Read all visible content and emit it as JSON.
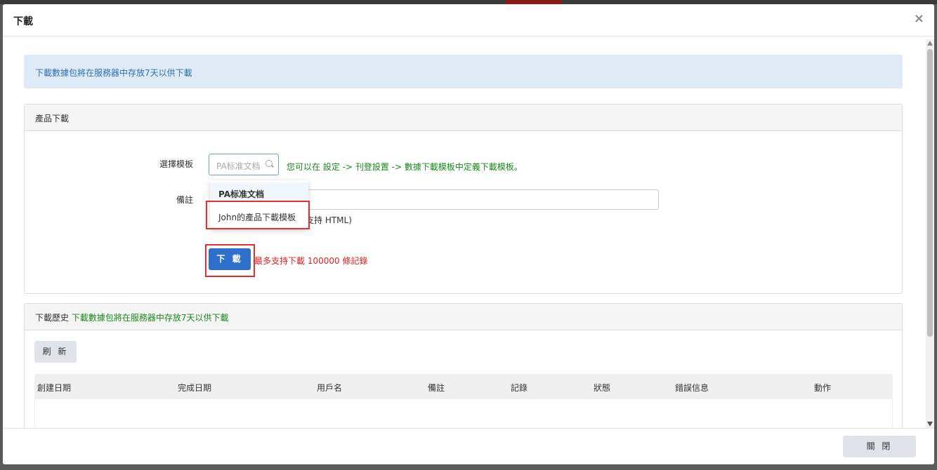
{
  "modal": {
    "title": "下載",
    "close_glyph": "×"
  },
  "info_alert": "下載數據包將在服務器中存放7天以供下載",
  "product_panel": {
    "heading": "產品下載",
    "template_label": "選擇模板",
    "template_placeholder": "PA标准文档",
    "template_hint": "您可以在 設定 -> 刊登設置 -> 數據下載模板中定義下載模板。",
    "dropdown_options": [
      "PA标准文档",
      "John的產品下載模板"
    ],
    "remark_label": "備註",
    "remark_value": "",
    "remark_note": "支持 HTML)",
    "download_label": "下 載",
    "limit_note": "最多支持下載 100000 條記錄"
  },
  "history_panel": {
    "heading": "下載歷史",
    "heading_note": "下載數據包將在服務器中存放7天以供下載",
    "refresh_label": "刷 新",
    "columns": [
      "創建日期",
      "完成日期",
      "用戶名",
      "備註",
      "記錄",
      "狀態",
      "錯誤信息",
      "動作"
    ]
  },
  "footer": {
    "close_label": "關 閉"
  },
  "colors": {
    "primary": "#2f6fcc",
    "alert_bg": "#deebf7",
    "hint_green": "#1a8a1a",
    "danger_red": "#e02020",
    "highlight_box": "#e03030"
  }
}
